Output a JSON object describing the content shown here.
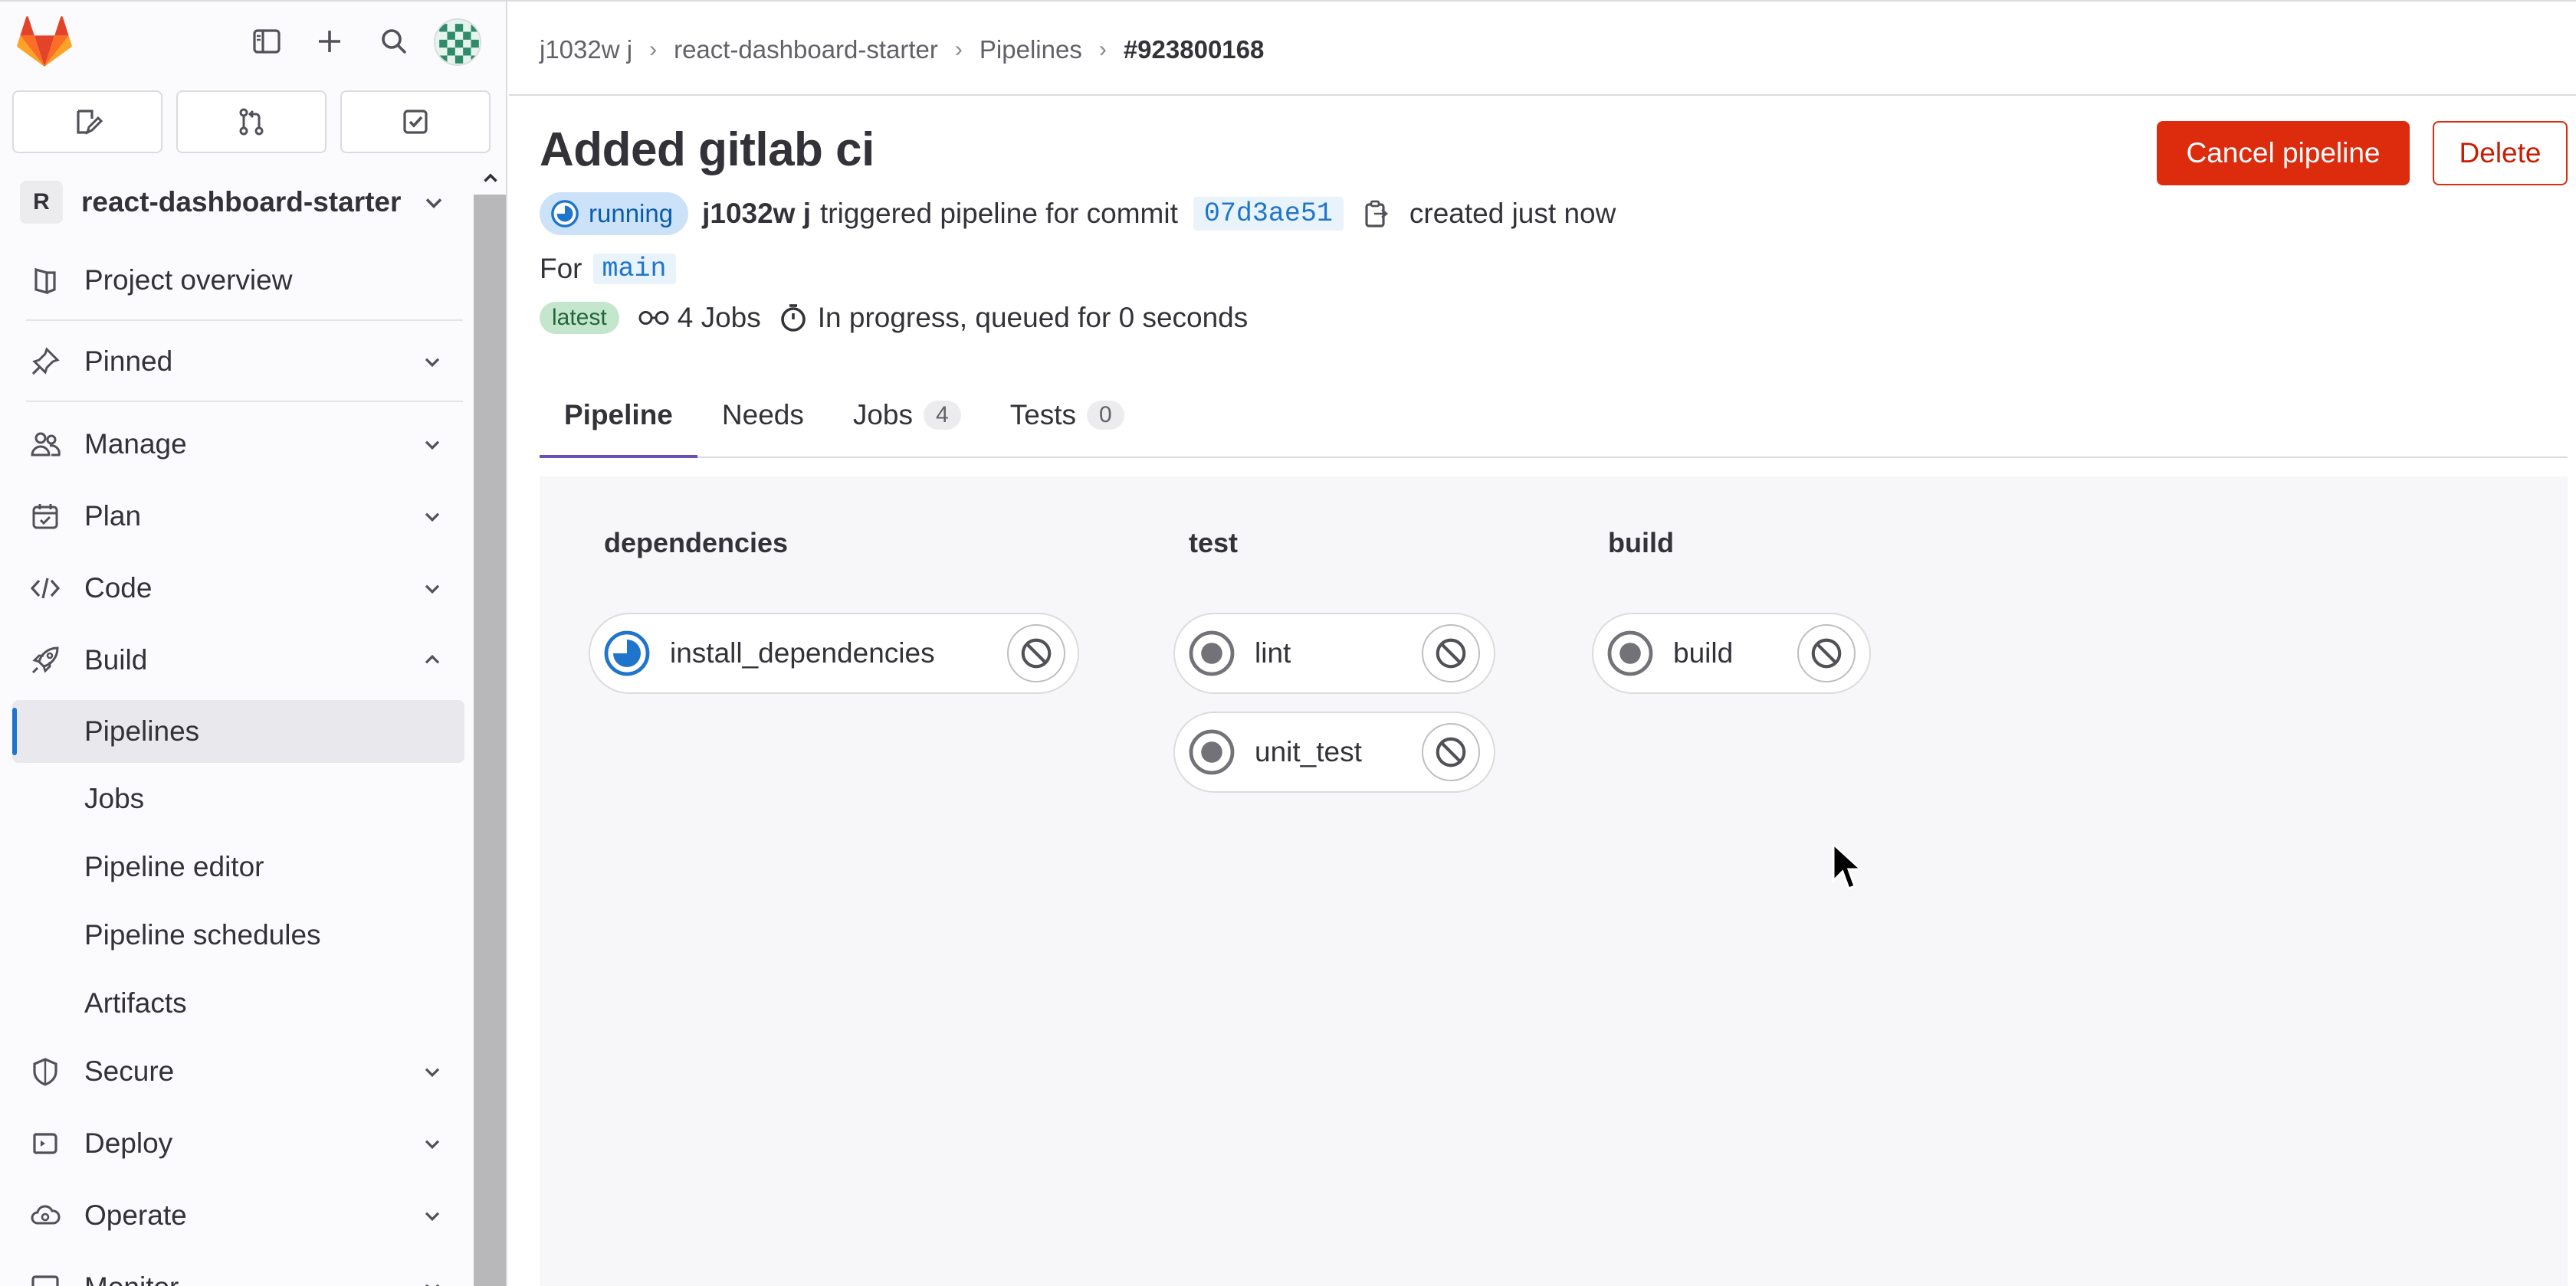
{
  "colors": {
    "brand_orange": "#fc6d26",
    "danger": "#dd2b0e",
    "running_blue": "#1f75cb",
    "latest_green": "#24663b",
    "tab_indicator": "#6b4fbb"
  },
  "sidebar": {
    "top_icons": [
      "gitlab-logo",
      "sidebar-toggle-icon",
      "plus-icon",
      "search-icon",
      "user-avatar"
    ],
    "quick_actions": [
      "issues-icon",
      "merge-request-icon",
      "todo-icon"
    ],
    "project": {
      "initial": "R",
      "name": "react-dashboard-starter"
    },
    "items": [
      {
        "label": "Project overview",
        "icon": "project-icon"
      },
      {
        "label": "Pinned",
        "icon": "pin-icon"
      },
      {
        "label": "Manage",
        "icon": "users-icon"
      },
      {
        "label": "Plan",
        "icon": "calendar-icon"
      },
      {
        "label": "Code",
        "icon": "code-icon"
      },
      {
        "label": "Build",
        "icon": "rocket-icon"
      },
      {
        "label": "Secure",
        "icon": "shield-icon"
      },
      {
        "label": "Deploy",
        "icon": "deploy-icon"
      },
      {
        "label": "Operate",
        "icon": "cloud-gear-icon"
      },
      {
        "label": "Monitor",
        "icon": "monitor-icon"
      }
    ],
    "build_subitems": [
      "Pipelines",
      "Jobs",
      "Pipeline editor",
      "Pipeline schedules",
      "Artifacts"
    ],
    "active_subitem": "Pipelines"
  },
  "breadcrumb": [
    "j1032w j",
    "react-dashboard-starter",
    "Pipelines",
    "#923800168"
  ],
  "pipeline": {
    "title": "Added gitlab ci",
    "status": "running",
    "user": "j1032w j",
    "triggered_text": "triggered pipeline for commit",
    "commit": "07d3ae51",
    "created": "created just now",
    "for_label": "For",
    "branch": "main",
    "badge": "latest",
    "jobs_count_text": "4 Jobs",
    "progress_text": "In progress, queued for 0 seconds"
  },
  "actions": {
    "cancel": "Cancel pipeline",
    "delete": "Delete"
  },
  "tabs": [
    {
      "label": "Pipeline",
      "count": null,
      "active": true
    },
    {
      "label": "Needs",
      "count": null,
      "active": false
    },
    {
      "label": "Jobs",
      "count": "4",
      "active": false
    },
    {
      "label": "Tests",
      "count": "0",
      "active": false
    }
  ],
  "stages": [
    {
      "name": "dependencies",
      "jobs": [
        {
          "name": "install_dependencies",
          "status": "running"
        }
      ]
    },
    {
      "name": "test",
      "jobs": [
        {
          "name": "lint",
          "status": "created"
        },
        {
          "name": "unit_test",
          "status": "created"
        }
      ]
    },
    {
      "name": "build",
      "jobs": [
        {
          "name": "build",
          "status": "created"
        }
      ]
    }
  ]
}
